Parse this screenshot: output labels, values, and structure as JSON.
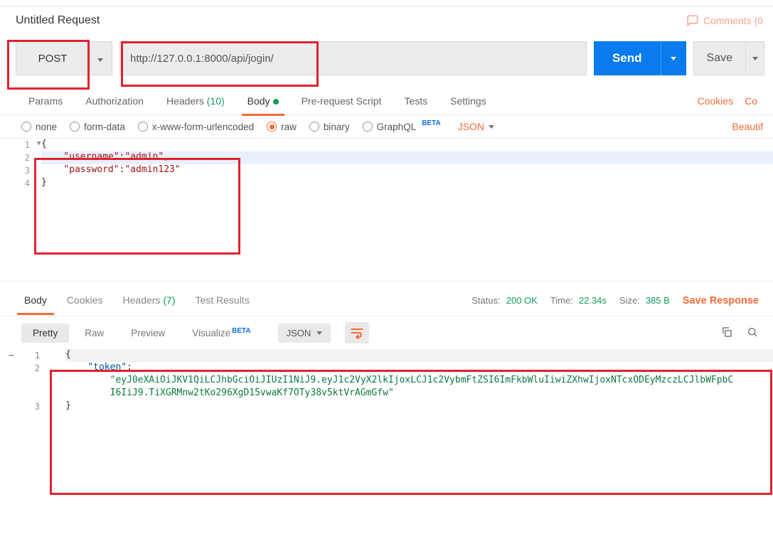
{
  "title": "Untitled Request",
  "comments": {
    "label": "Comments (0"
  },
  "request": {
    "method": "POST",
    "url": "http://127.0.0.1:8000/api/jogin/",
    "send_label": "Send",
    "save_label": "Save"
  },
  "req_tabs": {
    "params": "Params",
    "authorization": "Authorization",
    "headers": "Headers",
    "headers_count": "(10)",
    "body": "Body",
    "prerequest": "Pre-request Script",
    "tests": "Tests",
    "settings": "Settings",
    "cookies_link": "Cookies",
    "code_link": "Co"
  },
  "body_types": {
    "none": "none",
    "form_data": "form-data",
    "x_www": "x-www-form-urlencoded",
    "raw": "raw",
    "binary": "binary",
    "graphql": "GraphQL",
    "graphql_beta": "BETA",
    "json": "JSON",
    "beautify": "Beautif"
  },
  "req_body": {
    "l1": "{",
    "l2a": "    \"username\"",
    "l2b": ":",
    "l2c": "\"admin\"",
    "l2d": ",",
    "l3a": "    \"password\"",
    "l3b": ":",
    "l3c": "\"admin123\"",
    "l4": "}",
    "ln1": "1",
    "ln2": "2",
    "ln3": "3",
    "ln4": "4"
  },
  "resp_tabs": {
    "body": "Body",
    "cookies": "Cookies",
    "headers": "Headers",
    "headers_count": "(7)",
    "test_results": "Test Results"
  },
  "resp_meta": {
    "status_label": "Status:",
    "status_value": "200 OK",
    "time_label": "Time:",
    "time_value": "22.34s",
    "size_label": "Size:",
    "size_value": "385 B",
    "save_response": "Save Response"
  },
  "resp_views": {
    "pretty": "Pretty",
    "raw": "Raw",
    "preview": "Preview",
    "visualize": "Visualize",
    "visualize_beta": "BETA",
    "json": "JSON"
  },
  "resp_body": {
    "ln1": "1",
    "ln2": "2",
    "ln3": "3",
    "l1": "{",
    "l2a": "    \"token\"",
    "l2b": ":",
    "l2c": "        \"eyJ0eXAiOiJKV1QiLCJhbGciOiJIUzI1NiJ9.eyJ1c2VyX2lkIjoxLCJ1c2VybmFtZSI6ImFkbWluIiwiZXhwIjoxNTcxODEyMzczLCJlbWFpbC",
    "l2d": "        I6IiJ9.TiXGRMnw2tKo296XgD15vwaKf7OTy38v5ktVrAGmGfw\"",
    "l3": "}"
  }
}
